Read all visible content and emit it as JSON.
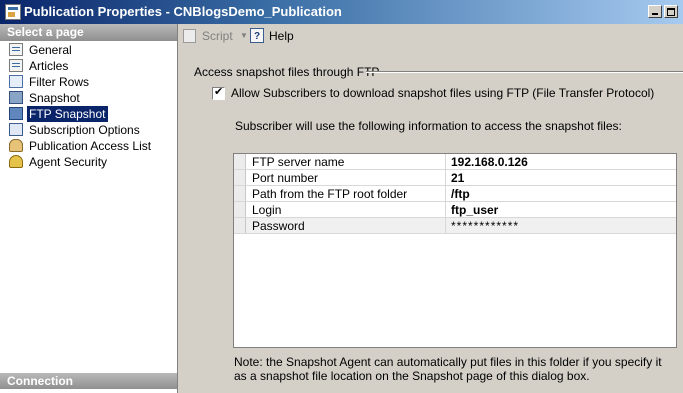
{
  "window": {
    "title": "Publication Properties - CNBlogsDemo_Publication"
  },
  "sidebar": {
    "header": "Select a page",
    "items": [
      {
        "label": "General",
        "icon": "general-page-icon"
      },
      {
        "label": "Articles",
        "icon": "articles-icon"
      },
      {
        "label": "Filter Rows",
        "icon": "filter-rows-icon"
      },
      {
        "label": "Snapshot",
        "icon": "snapshot-icon"
      },
      {
        "label": "FTP Snapshot",
        "icon": "ftp-snapshot-icon",
        "selected": true
      },
      {
        "label": "Subscription Options",
        "icon": "subscription-options-icon"
      },
      {
        "label": "Publication Access List",
        "icon": "publication-access-list-icon"
      },
      {
        "label": "Agent Security",
        "icon": "agent-security-icon"
      }
    ],
    "connection_header": "Connection"
  },
  "toolbar": {
    "script_label": "Script",
    "help_label": "Help"
  },
  "content": {
    "group_title": "Access snapshot files through FTP",
    "allow_checkbox": {
      "label": "Allow Subscribers to download snapshot files using FTP (File Transfer Protocol)",
      "checked": true
    },
    "info_text": "Subscriber will use the following information to access the snapshot files:",
    "grid": [
      {
        "name": "FTP server name",
        "value": "192.168.0.126"
      },
      {
        "name": "Port number",
        "value": "21"
      },
      {
        "name": "Path from the FTP root folder",
        "value": "/ftp"
      },
      {
        "name": "Login",
        "value": "ftp_user"
      },
      {
        "name": "Password",
        "value": "************"
      }
    ],
    "note": "Note: the Snapshot Agent can automatically put files in this folder if you specify it as a snapshot file location on the Snapshot page of this dialog box."
  },
  "colors": {
    "titlebar_start": "#0a246a",
    "selection": "#0a246a",
    "dialog_bg": "#d4d0c8"
  }
}
